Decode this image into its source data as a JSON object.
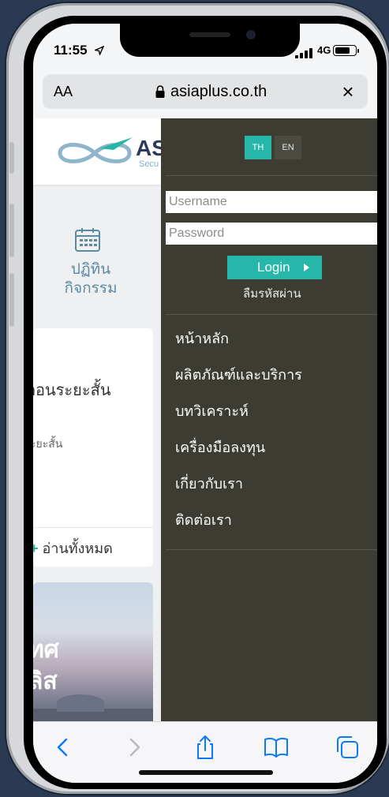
{
  "status": {
    "time": "11:55",
    "network": "4G",
    "battery_level": 0.8
  },
  "browser": {
    "text_size_label": "AA",
    "domain": "asiaplus.co.th"
  },
  "page": {
    "logo_text": "AS",
    "logo_sub": "Secu",
    "activity_label_line1": "ปฏิทิน",
    "activity_label_line2": "กิจกรรม",
    "card_title": "ตอนระยะสั้น",
    "card_sub": "ะยะสั้น",
    "read_all_plus": "+",
    "read_all": "อ่านทั้งหมด",
    "promo_line1": "ทศ",
    "promo_line2": "ลิส"
  },
  "drawer": {
    "lang_th": "TH",
    "lang_en": "EN",
    "username_placeholder": "Username",
    "password_placeholder": "Password",
    "login_label": "Login",
    "forgot_password": "ลืมรหัสผ่าน",
    "menu": [
      "หน้าหลัก",
      "ผลิตภัณฑ์และบริการ",
      "บทวิเคราะห์",
      "เครื่องมือลงทุน",
      "เกี่ยวกับเรา",
      "ติดต่อเรา"
    ]
  },
  "colors": {
    "accent": "#27b7aa",
    "drawer_bg": "#3c3c32",
    "link_blue": "#0a7aff"
  }
}
